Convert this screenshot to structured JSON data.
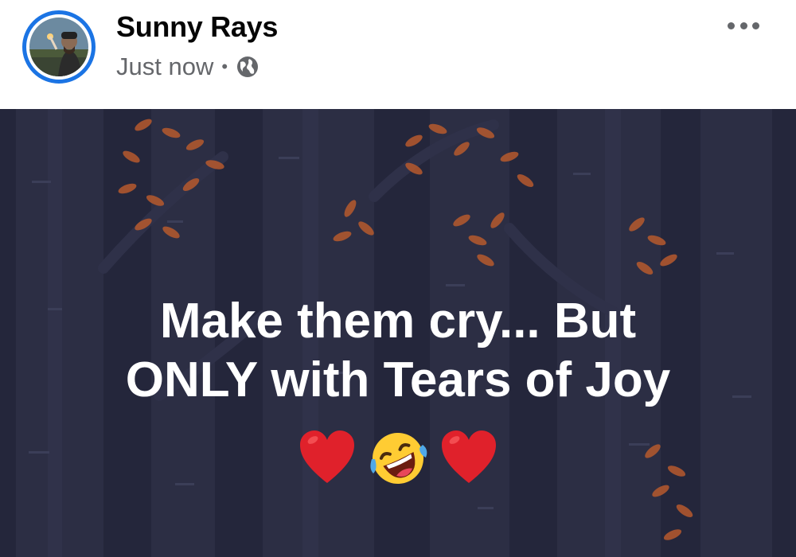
{
  "post": {
    "author": "Sunny Rays",
    "timestamp": "Just now",
    "separator": "•",
    "privacy_icon": "globe-icon",
    "more_icon": "more-options-icon",
    "text_line1": "Make them cry... But",
    "text_line2": "ONLY with Tears of Joy",
    "emojis": [
      "red-heart",
      "rolling-on-floor-laughing",
      "red-heart"
    ],
    "colors": {
      "background": "#24263b",
      "avatar_ring": "#1b74e4",
      "leaf": "#b85a2e",
      "text": "#ffffff"
    }
  }
}
